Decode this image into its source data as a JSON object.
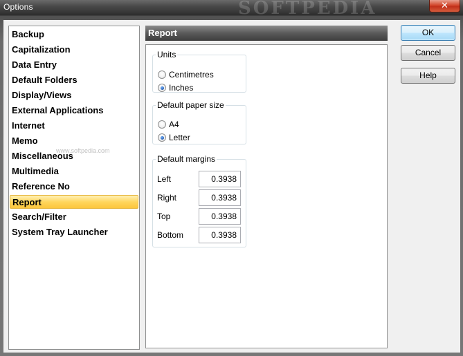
{
  "window": {
    "title": "Options",
    "watermark": "SOFTPEDIA",
    "close_glyph": "✕"
  },
  "sidebar": {
    "items": [
      {
        "label": "Backup",
        "selected": false
      },
      {
        "label": "Capitalization",
        "selected": false
      },
      {
        "label": "Data Entry",
        "selected": false
      },
      {
        "label": "Default Folders",
        "selected": false
      },
      {
        "label": "Display/Views",
        "selected": false
      },
      {
        "label": "External Applications",
        "selected": false
      },
      {
        "label": "Internet",
        "selected": false
      },
      {
        "label": "Memo",
        "selected": false
      },
      {
        "label": "Miscellaneous",
        "selected": false
      },
      {
        "label": "Multimedia",
        "selected": false
      },
      {
        "label": "Reference No",
        "selected": false
      },
      {
        "label": "Report",
        "selected": true
      },
      {
        "label": "Search/Filter",
        "selected": false
      },
      {
        "label": "System Tray Launcher",
        "selected": false
      }
    ],
    "watermark": "www.softpedia.com"
  },
  "panel": {
    "title": "Report",
    "units": {
      "legend": "Units",
      "options": [
        {
          "label": "Centimetres",
          "checked": false
        },
        {
          "label": "Inches",
          "checked": true
        }
      ]
    },
    "paper": {
      "legend": "Default paper size",
      "options": [
        {
          "label": "A4",
          "checked": false
        },
        {
          "label": "Letter",
          "checked": true
        }
      ]
    },
    "margins": {
      "legend": "Default margins",
      "rows": [
        {
          "label": "Left",
          "value": "0.3938"
        },
        {
          "label": "Right",
          "value": "0.3938"
        },
        {
          "label": "Top",
          "value": "0.3938"
        },
        {
          "label": "Bottom",
          "value": "0.3938"
        }
      ]
    }
  },
  "buttons": {
    "ok": "OK",
    "cancel": "Cancel",
    "help": "Help"
  },
  "colors": {
    "selection": "#ffd65e",
    "header": "#5a5a5a",
    "default_button_border": "#3c7fb1"
  }
}
